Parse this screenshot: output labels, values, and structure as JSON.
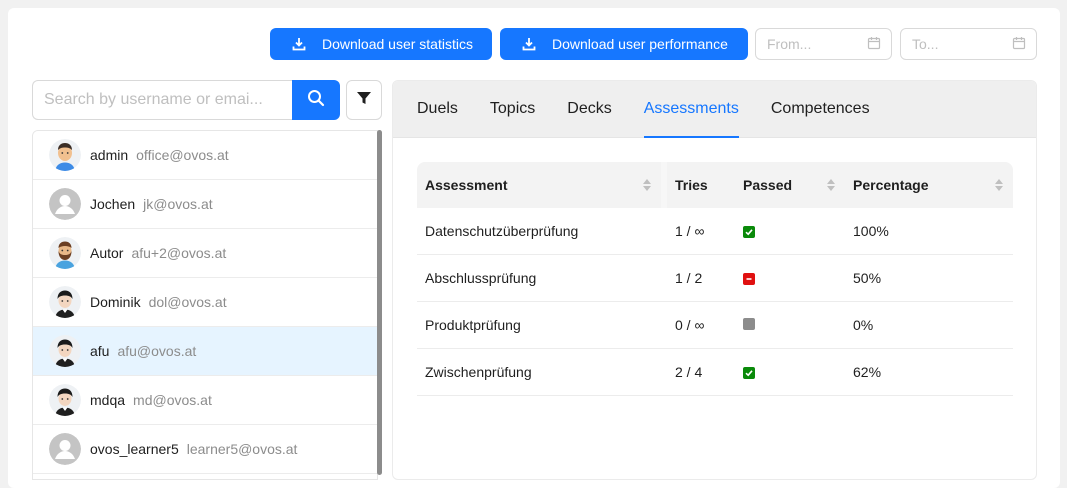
{
  "toolbar": {
    "download_stats_label": "Download user statistics",
    "download_performance_label": "Download user performance",
    "from_placeholder": "From...",
    "to_placeholder": "To..."
  },
  "search": {
    "placeholder": "Search by username or emai..."
  },
  "users": [
    {
      "name": "admin",
      "email": "office@ovos.at",
      "avatar": "admin-avatar-icon",
      "selected": false
    },
    {
      "name": "Jochen",
      "email": "jk@ovos.at",
      "avatar": "default-avatar-icon",
      "selected": false
    },
    {
      "name": "Autor",
      "email": "afu+2@ovos.at",
      "avatar": "bearded-avatar-icon",
      "selected": false
    },
    {
      "name": "Dominik",
      "email": "dol@ovos.at",
      "avatar": "dark-hair-avatar-icon",
      "selected": false
    },
    {
      "name": "afu",
      "email": "afu@ovos.at",
      "avatar": "dark-hair-avatar-icon",
      "selected": true
    },
    {
      "name": "mdqa",
      "email": "md@ovos.at",
      "avatar": "dark-hair-avatar-icon",
      "selected": false
    },
    {
      "name": "ovos_learner5",
      "email": "learner5@ovos.at",
      "avatar": "default-avatar-icon",
      "selected": false
    }
  ],
  "tabs": [
    {
      "label": "Duels",
      "active": false
    },
    {
      "label": "Topics",
      "active": false
    },
    {
      "label": "Decks",
      "active": false
    },
    {
      "label": "Assessments",
      "active": true
    },
    {
      "label": "Competences",
      "active": false
    }
  ],
  "table": {
    "headers": {
      "assessment": "Assessment",
      "tries": "Tries",
      "passed": "Passed",
      "percentage": "Percentage"
    },
    "rows": [
      {
        "assessment": "Datenschutzüberprüfung",
        "tries": "1 / ∞",
        "passed": "passed",
        "percentage": "100%"
      },
      {
        "assessment": "Abschlussprüfung",
        "tries": "1 / 2",
        "passed": "failed",
        "percentage": "50%"
      },
      {
        "assessment": "Produktprüfung",
        "tries": "0 / ∞",
        "passed": "not-attempted",
        "percentage": "0%"
      },
      {
        "assessment": "Zwischenprüfung",
        "tries": "2 / 4",
        "passed": "passed",
        "percentage": "62%"
      }
    ]
  },
  "colors": {
    "primary": "#1677ff",
    "passed": "#0a8a0a",
    "failed": "#e01010",
    "not_attempted": "#8c8c8c",
    "selected_row": "#e6f4ff"
  }
}
